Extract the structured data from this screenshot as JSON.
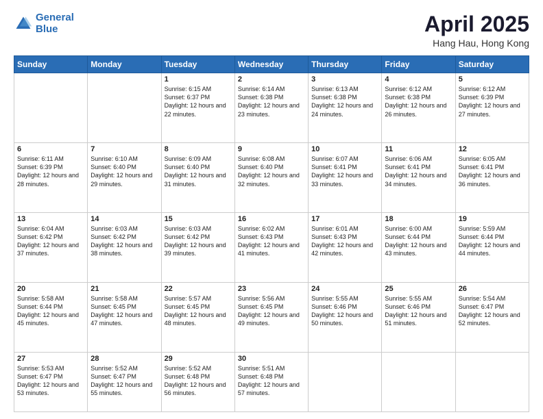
{
  "logo": {
    "line1": "General",
    "line2": "Blue"
  },
  "title": "April 2025",
  "location": "Hang Hau, Hong Kong",
  "days_header": [
    "Sunday",
    "Monday",
    "Tuesday",
    "Wednesday",
    "Thursday",
    "Friday",
    "Saturday"
  ],
  "weeks": [
    [
      {
        "day": "",
        "sunrise": "",
        "sunset": "",
        "daylight": ""
      },
      {
        "day": "",
        "sunrise": "",
        "sunset": "",
        "daylight": ""
      },
      {
        "day": "1",
        "sunrise": "Sunrise: 6:15 AM",
        "sunset": "Sunset: 6:37 PM",
        "daylight": "Daylight: 12 hours and 22 minutes."
      },
      {
        "day": "2",
        "sunrise": "Sunrise: 6:14 AM",
        "sunset": "Sunset: 6:38 PM",
        "daylight": "Daylight: 12 hours and 23 minutes."
      },
      {
        "day": "3",
        "sunrise": "Sunrise: 6:13 AM",
        "sunset": "Sunset: 6:38 PM",
        "daylight": "Daylight: 12 hours and 24 minutes."
      },
      {
        "day": "4",
        "sunrise": "Sunrise: 6:12 AM",
        "sunset": "Sunset: 6:38 PM",
        "daylight": "Daylight: 12 hours and 26 minutes."
      },
      {
        "day": "5",
        "sunrise": "Sunrise: 6:12 AM",
        "sunset": "Sunset: 6:39 PM",
        "daylight": "Daylight: 12 hours and 27 minutes."
      }
    ],
    [
      {
        "day": "6",
        "sunrise": "Sunrise: 6:11 AM",
        "sunset": "Sunset: 6:39 PM",
        "daylight": "Daylight: 12 hours and 28 minutes."
      },
      {
        "day": "7",
        "sunrise": "Sunrise: 6:10 AM",
        "sunset": "Sunset: 6:40 PM",
        "daylight": "Daylight: 12 hours and 29 minutes."
      },
      {
        "day": "8",
        "sunrise": "Sunrise: 6:09 AM",
        "sunset": "Sunset: 6:40 PM",
        "daylight": "Daylight: 12 hours and 31 minutes."
      },
      {
        "day": "9",
        "sunrise": "Sunrise: 6:08 AM",
        "sunset": "Sunset: 6:40 PM",
        "daylight": "Daylight: 12 hours and 32 minutes."
      },
      {
        "day": "10",
        "sunrise": "Sunrise: 6:07 AM",
        "sunset": "Sunset: 6:41 PM",
        "daylight": "Daylight: 12 hours and 33 minutes."
      },
      {
        "day": "11",
        "sunrise": "Sunrise: 6:06 AM",
        "sunset": "Sunset: 6:41 PM",
        "daylight": "Daylight: 12 hours and 34 minutes."
      },
      {
        "day": "12",
        "sunrise": "Sunrise: 6:05 AM",
        "sunset": "Sunset: 6:41 PM",
        "daylight": "Daylight: 12 hours and 36 minutes."
      }
    ],
    [
      {
        "day": "13",
        "sunrise": "Sunrise: 6:04 AM",
        "sunset": "Sunset: 6:42 PM",
        "daylight": "Daylight: 12 hours and 37 minutes."
      },
      {
        "day": "14",
        "sunrise": "Sunrise: 6:03 AM",
        "sunset": "Sunset: 6:42 PM",
        "daylight": "Daylight: 12 hours and 38 minutes."
      },
      {
        "day": "15",
        "sunrise": "Sunrise: 6:03 AM",
        "sunset": "Sunset: 6:42 PM",
        "daylight": "Daylight: 12 hours and 39 minutes."
      },
      {
        "day": "16",
        "sunrise": "Sunrise: 6:02 AM",
        "sunset": "Sunset: 6:43 PM",
        "daylight": "Daylight: 12 hours and 41 minutes."
      },
      {
        "day": "17",
        "sunrise": "Sunrise: 6:01 AM",
        "sunset": "Sunset: 6:43 PM",
        "daylight": "Daylight: 12 hours and 42 minutes."
      },
      {
        "day": "18",
        "sunrise": "Sunrise: 6:00 AM",
        "sunset": "Sunset: 6:44 PM",
        "daylight": "Daylight: 12 hours and 43 minutes."
      },
      {
        "day": "19",
        "sunrise": "Sunrise: 5:59 AM",
        "sunset": "Sunset: 6:44 PM",
        "daylight": "Daylight: 12 hours and 44 minutes."
      }
    ],
    [
      {
        "day": "20",
        "sunrise": "Sunrise: 5:58 AM",
        "sunset": "Sunset: 6:44 PM",
        "daylight": "Daylight: 12 hours and 45 minutes."
      },
      {
        "day": "21",
        "sunrise": "Sunrise: 5:58 AM",
        "sunset": "Sunset: 6:45 PM",
        "daylight": "Daylight: 12 hours and 47 minutes."
      },
      {
        "day": "22",
        "sunrise": "Sunrise: 5:57 AM",
        "sunset": "Sunset: 6:45 PM",
        "daylight": "Daylight: 12 hours and 48 minutes."
      },
      {
        "day": "23",
        "sunrise": "Sunrise: 5:56 AM",
        "sunset": "Sunset: 6:45 PM",
        "daylight": "Daylight: 12 hours and 49 minutes."
      },
      {
        "day": "24",
        "sunrise": "Sunrise: 5:55 AM",
        "sunset": "Sunset: 6:46 PM",
        "daylight": "Daylight: 12 hours and 50 minutes."
      },
      {
        "day": "25",
        "sunrise": "Sunrise: 5:55 AM",
        "sunset": "Sunset: 6:46 PM",
        "daylight": "Daylight: 12 hours and 51 minutes."
      },
      {
        "day": "26",
        "sunrise": "Sunrise: 5:54 AM",
        "sunset": "Sunset: 6:47 PM",
        "daylight": "Daylight: 12 hours and 52 minutes."
      }
    ],
    [
      {
        "day": "27",
        "sunrise": "Sunrise: 5:53 AM",
        "sunset": "Sunset: 6:47 PM",
        "daylight": "Daylight: 12 hours and 53 minutes."
      },
      {
        "day": "28",
        "sunrise": "Sunrise: 5:52 AM",
        "sunset": "Sunset: 6:47 PM",
        "daylight": "Daylight: 12 hours and 55 minutes."
      },
      {
        "day": "29",
        "sunrise": "Sunrise: 5:52 AM",
        "sunset": "Sunset: 6:48 PM",
        "daylight": "Daylight: 12 hours and 56 minutes."
      },
      {
        "day": "30",
        "sunrise": "Sunrise: 5:51 AM",
        "sunset": "Sunset: 6:48 PM",
        "daylight": "Daylight: 12 hours and 57 minutes."
      },
      {
        "day": "",
        "sunrise": "",
        "sunset": "",
        "daylight": ""
      },
      {
        "day": "",
        "sunrise": "",
        "sunset": "",
        "daylight": ""
      },
      {
        "day": "",
        "sunrise": "",
        "sunset": "",
        "daylight": ""
      }
    ]
  ]
}
